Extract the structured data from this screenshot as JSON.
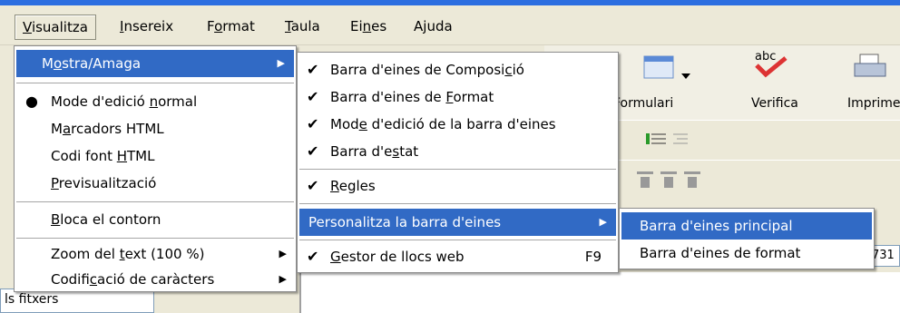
{
  "menubar": {
    "items": [
      {
        "pre": "",
        "u": "V",
        "post": "isualitza"
      },
      {
        "pre": "",
        "u": "I",
        "post": "nsereix"
      },
      {
        "pre": "F",
        "u": "o",
        "post": "rmat"
      },
      {
        "pre": "",
        "u": "T",
        "post": "aula"
      },
      {
        "pre": "Ei",
        "u": "n",
        "post": "es"
      },
      {
        "pre": "A",
        "u": "j",
        "post": "uda"
      }
    ]
  },
  "toolbar": {
    "formulari": "Formulari",
    "verifica": "Verifica",
    "imprimeix": "Imprime",
    "field_value": "731",
    "left_text": "ls fitxers"
  },
  "visualitza_menu": {
    "mostra": {
      "pre": "M",
      "u": "o",
      "post": "stra/Amaga"
    },
    "mode_normal": {
      "pre": "Mode d'edició ",
      "u": "n",
      "post": "ormal"
    },
    "marcadors": {
      "pre": "M",
      "u": "a",
      "post": "rcadors HTML"
    },
    "codi_font": {
      "pre": "Codi font ",
      "u": "H",
      "post": "TML"
    },
    "previsualitzacio": {
      "pre": "",
      "u": "P",
      "post": "revisualització"
    },
    "bloca": {
      "pre": "",
      "u": "B",
      "post": "loca el contorn"
    },
    "zoom": {
      "pre": "Zoom del ",
      "u": "t",
      "post": "ext (100 %)"
    },
    "codificacio": {
      "pre": "Codifi",
      "u": "c",
      "post": "ació de caràcters"
    }
  },
  "mostra_submenu": {
    "composicio": {
      "pre": "Barra d'eines de Composi",
      "u": "c",
      "post": "ió"
    },
    "format": {
      "pre": "Barra d'eines de ",
      "u": "F",
      "post": "ormat"
    },
    "mode_edicio": {
      "pre": "Mod",
      "u": "e",
      "post": " d'edició de la barra d'eines"
    },
    "estat": {
      "pre": "Barra d'e",
      "u": "s",
      "post": "tat"
    },
    "regles": {
      "pre": "",
      "u": "R",
      "post": "egles"
    },
    "personalitza": "Personalitza la barra d'eines",
    "gestor": {
      "pre": "",
      "u": "G",
      "post": "estor de llocs web"
    },
    "gestor_key": "F9"
  },
  "personalitza_submenu": {
    "principal": "Barra d'eines principal",
    "format": "Barra d'eines de format"
  }
}
